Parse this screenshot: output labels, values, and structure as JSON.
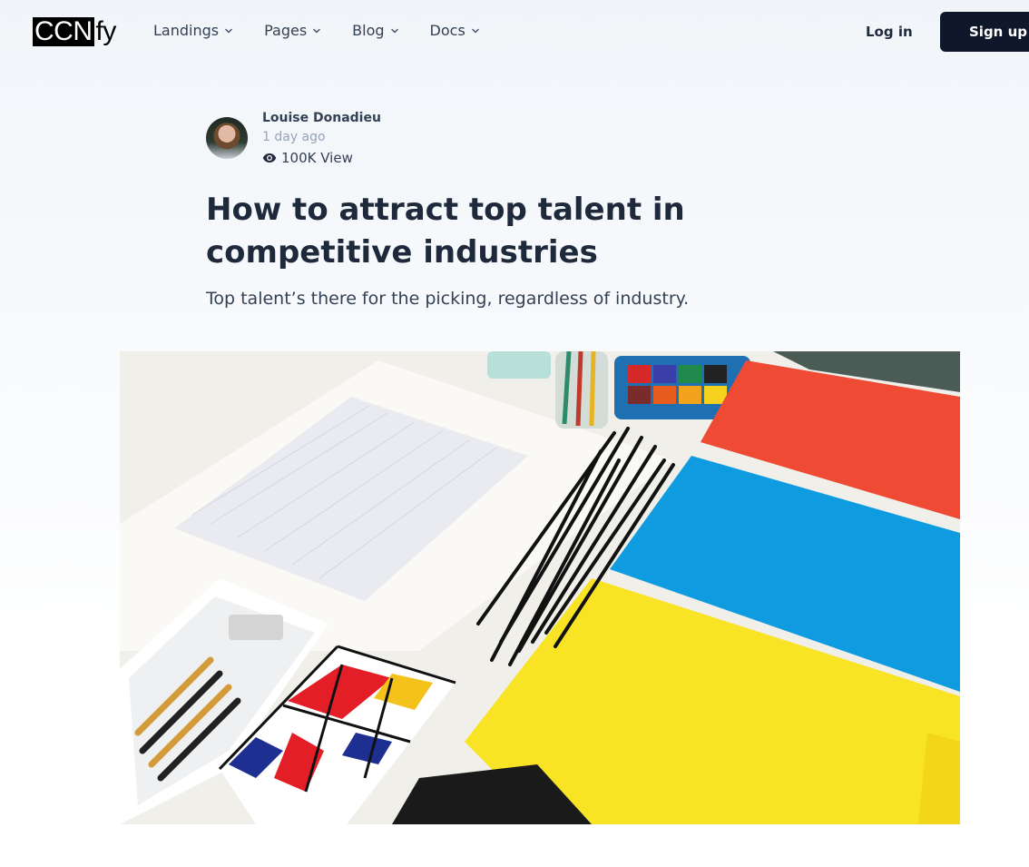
{
  "brand": {
    "logo_boxed": "CCN",
    "logo_tail": "fy"
  },
  "nav": {
    "items": [
      {
        "label": "Landings"
      },
      {
        "label": "Pages"
      },
      {
        "label": "Blog"
      },
      {
        "label": "Docs"
      }
    ],
    "login_label": "Log in",
    "signup_label": "Sign up"
  },
  "post": {
    "author": "Louise Donadieu",
    "time": "1 day ago",
    "views": "100K View",
    "title": "How to attract top talent in competitive industries",
    "subtitle": "Top talent’s there for the picking, regardless of industry."
  },
  "colors": {
    "primary_button": "#0f172a",
    "heading": "#1e293b",
    "muted": "#94a3b8"
  },
  "icons": {
    "nav_dropdown": "chevron-down-icon",
    "views": "eye-icon"
  }
}
